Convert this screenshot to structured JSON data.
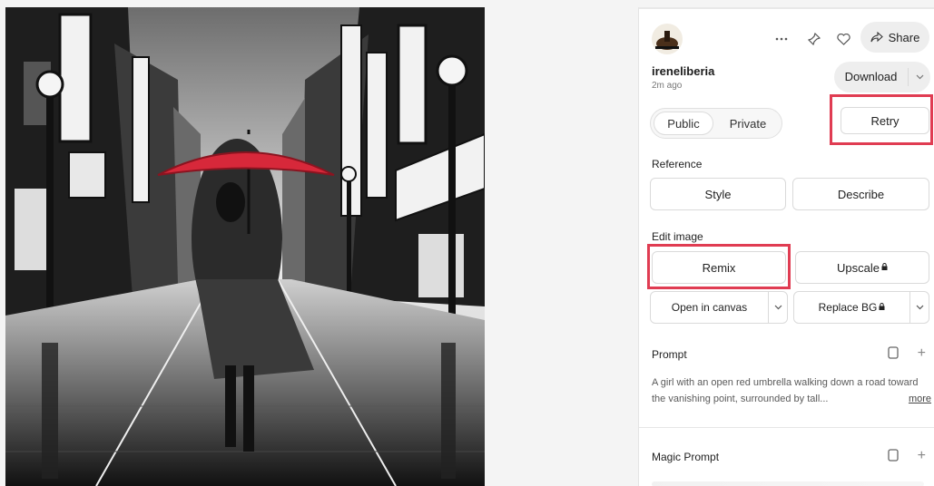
{
  "panel": {
    "user": {
      "name": "ireneliberia",
      "time": "2m ago"
    },
    "header": {
      "more_icon": "more-horizontal-icon",
      "pin_icon": "pin-icon",
      "like_icon": "heart-icon",
      "share_label": "Share"
    },
    "download": {
      "label": "Download"
    },
    "visibility": {
      "public": "Public",
      "private": "Private",
      "selected": "Public"
    },
    "retry": {
      "label": "Retry"
    },
    "reference": {
      "title": "Reference",
      "style": "Style",
      "describe": "Describe"
    },
    "edit": {
      "title": "Edit image",
      "remix": "Remix",
      "upscale": "Upscale",
      "open_canvas": "Open in canvas",
      "replace_bg": "Replace BG"
    },
    "prompt": {
      "title": "Prompt",
      "text": "A girl with an open red umbrella walking down a road toward the vanishing point, surrounded by tall...",
      "more": "more"
    },
    "magic_prompt": {
      "title": "Magic Prompt"
    }
  },
  "colors": {
    "highlight": "#e03c52",
    "umbrella": "#d7283a"
  }
}
